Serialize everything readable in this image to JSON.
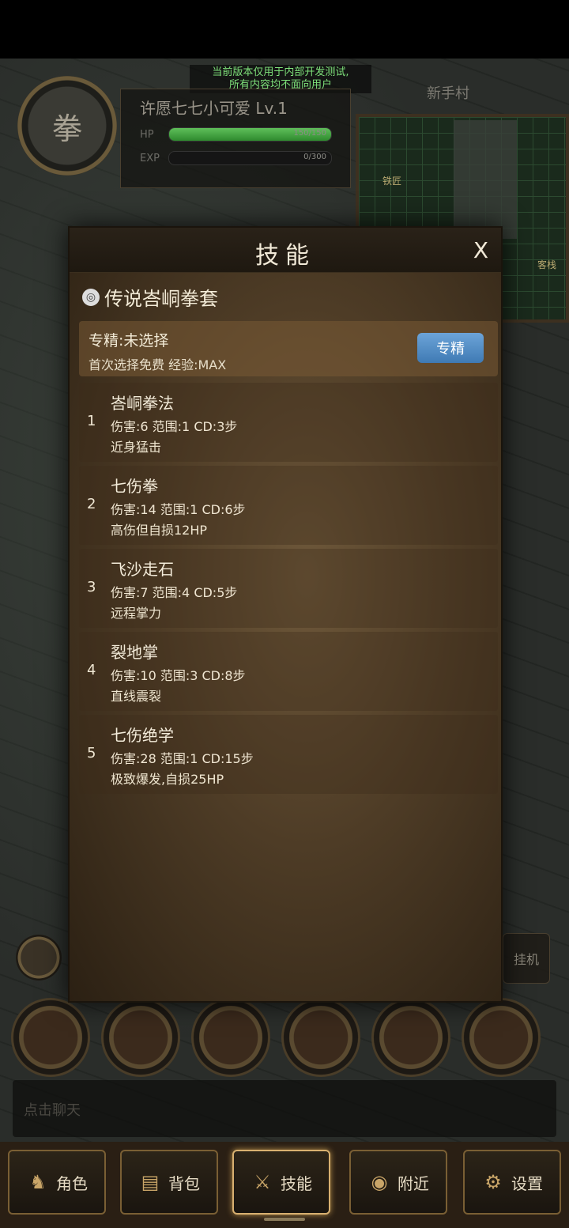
{
  "dev_notice": {
    "line1": "当前版本仅用于内部开发测试,",
    "line2": "所有内容均不面向用户"
  },
  "player": {
    "avatar_glyph": "拳",
    "name": "许愿七七小可爱",
    "level": "Lv.1",
    "hp_label": "HP",
    "hp_value": "150/150",
    "hp_fraction": 1.0,
    "exp_label": "EXP",
    "exp_value": "0/300",
    "exp_fraction": 0.0
  },
  "map": {
    "title": "新手村",
    "label_a": "铁匠",
    "label_b": "客栈"
  },
  "modal": {
    "title": "技能",
    "close": "X",
    "section_title": "传说峇峒拳套",
    "spec_line": "专精:未选择",
    "spec_sub": "首次选择免费  经验:MAX",
    "spec_button": "专精",
    "skills": [
      {
        "idx": "1",
        "name": "峇峒拳法",
        "stats": "伤害:6  范围:1  CD:3步",
        "desc": "近身猛击"
      },
      {
        "idx": "2",
        "name": "七伤拳",
        "stats": "伤害:14  范围:1  CD:6步",
        "desc": "高伤但自损12HP"
      },
      {
        "idx": "3",
        "name": "飞沙走石",
        "stats": "伤害:7  范围:4  CD:5步",
        "desc": "远程掌力"
      },
      {
        "idx": "4",
        "name": "裂地掌",
        "stats": "伤害:10  范围:3  CD:8步",
        "desc": "直线震裂"
      },
      {
        "idx": "5",
        "name": "七伤绝学",
        "stats": "伤害:28  范围:1  CD:15步",
        "desc": "极致爆发,自损25HP"
      }
    ]
  },
  "hud": {
    "auto_button": "挂机",
    "chat_placeholder": "点击聊天"
  },
  "nav": [
    {
      "label": "角色",
      "icon": "character-icon"
    },
    {
      "label": "背包",
      "icon": "bag-icon"
    },
    {
      "label": "技能",
      "icon": "skill-icon"
    },
    {
      "label": "附近",
      "icon": "nearby-icon"
    },
    {
      "label": "设置",
      "icon": "gear-icon"
    }
  ]
}
